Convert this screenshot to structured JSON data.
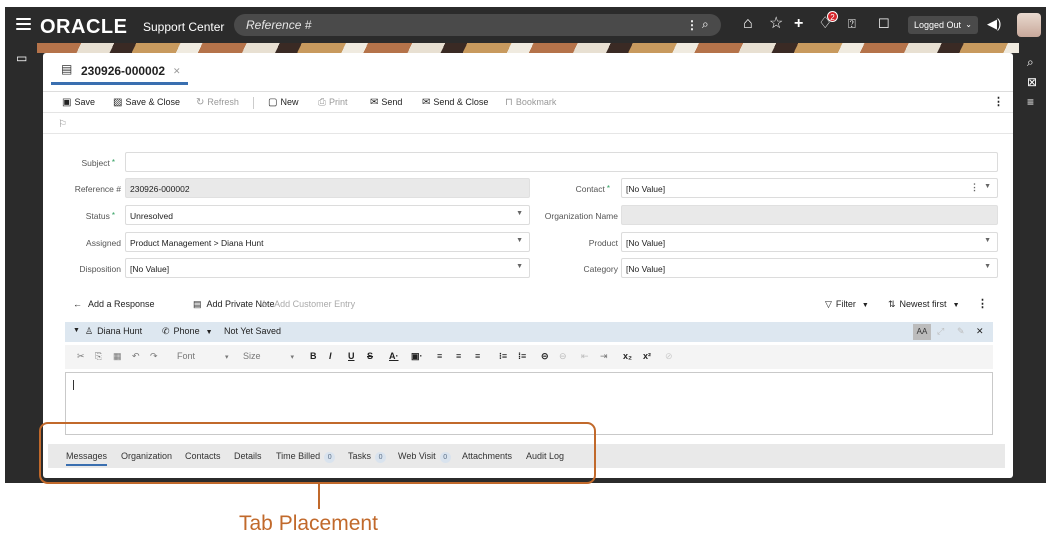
{
  "topbar": {
    "brand": "ORACLE",
    "app_name": "Support Center",
    "search_placeholder": "Reference #",
    "notification_count": "2",
    "login_status": "Logged Out",
    "icons": [
      "menu-icon",
      "search-icon",
      "home-icon",
      "star-icon",
      "plus-icon",
      "notification-icon",
      "help-icon",
      "chat-icon",
      "speaker-icon"
    ]
  },
  "record": {
    "number": "230926-000002"
  },
  "toolbar": {
    "save": "Save",
    "save_close": "Save & Close",
    "refresh": "Refresh",
    "new": "New",
    "print": "Print",
    "send": "Send",
    "send_close": "Send & Close",
    "bookmark": "Bookmark"
  },
  "form": {
    "subject_label": "Subject",
    "subject_value": "",
    "reference_label": "Reference #",
    "reference_value": "230926-000002",
    "status_label": "Status",
    "status_value": "Unresolved",
    "assigned_label": "Assigned",
    "assigned_value": "Product Management > Diana Hunt",
    "disposition_label": "Disposition",
    "disposition_value": "[No Value]",
    "contact_label": "Contact",
    "contact_value": "[No Value]",
    "organization_label": "Organization Name",
    "organization_value": "",
    "product_label": "Product",
    "product_value": "[No Value]",
    "category_label": "Category",
    "category_value": "[No Value]"
  },
  "response": {
    "add_response": "Add a Response",
    "add_private_note": "Add Private Note",
    "add_customer_entry": "Add Customer Entry",
    "filter": "Filter",
    "sort": "Newest first"
  },
  "editor": {
    "author": "Diana Hunt",
    "channel": "Phone",
    "save_state": "Not Yet Saved",
    "font_label": "Font",
    "size_label": "Size",
    "font_size_toggle": "AA"
  },
  "tabs": [
    {
      "label": "Messages"
    },
    {
      "label": "Organization"
    },
    {
      "label": "Contacts"
    },
    {
      "label": "Details"
    },
    {
      "label": "Time Billed",
      "count": "0"
    },
    {
      "label": "Tasks",
      "count": "0"
    },
    {
      "label": "Web Visit",
      "count": "0"
    },
    {
      "label": "Attachments"
    },
    {
      "label": "Audit Log"
    }
  ],
  "annotation": {
    "caption": "Tab Placement",
    "color": "#c1692b"
  }
}
